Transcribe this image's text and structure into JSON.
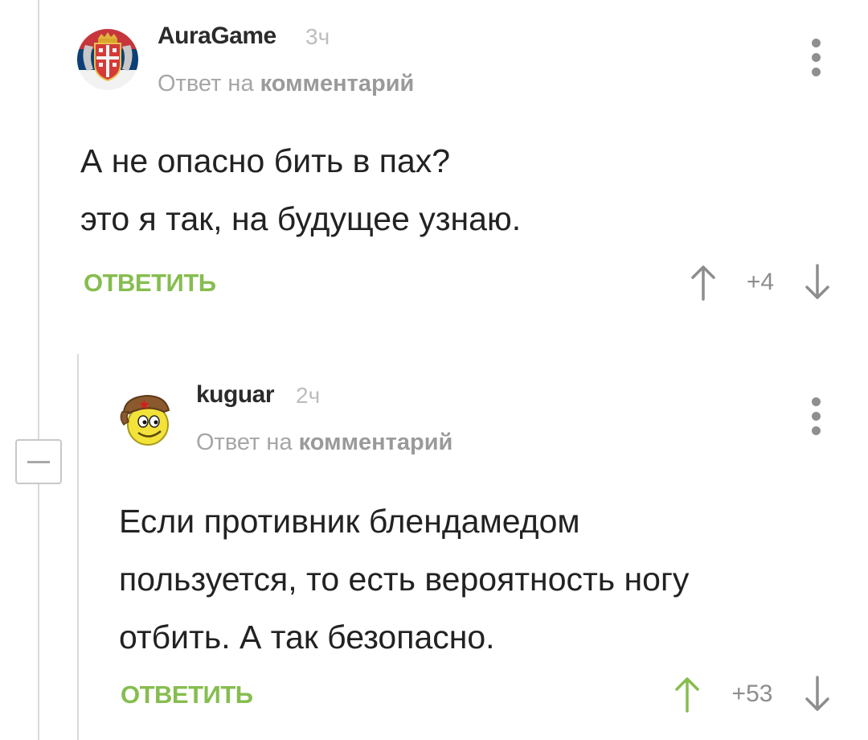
{
  "comments": [
    {
      "username": "AuraGame",
      "time": "3ч",
      "reply_prefix": "Ответ на",
      "reply_link": "комментарий",
      "text_lines": [
        "А не опасно бить в пах?",
        "это я так, на будущее узнаю."
      ],
      "reply_label": "ОТВЕТИТЬ",
      "rating": "+4",
      "upvote_color": "#8d8d8d",
      "avatar_icon": "serbia-coat-of-arms-avatar"
    },
    {
      "username": "kuguar",
      "time": "2ч",
      "reply_prefix": "Ответ на",
      "reply_link": "комментарий",
      "text_lines": [
        "Если противник блендамедом",
        "пользуется, то есть вероятность ногу",
        "отбить. А так безопасно."
      ],
      "reply_label": "ОТВЕТИТЬ",
      "rating": "+53",
      "upvote_color": "#86bd4f",
      "avatar_icon": "smiley-ushanka-avatar"
    }
  ],
  "colors": {
    "accent_green": "#86bd4f",
    "thread_line": "#dadada",
    "muted_text": "#a6a6a6"
  }
}
